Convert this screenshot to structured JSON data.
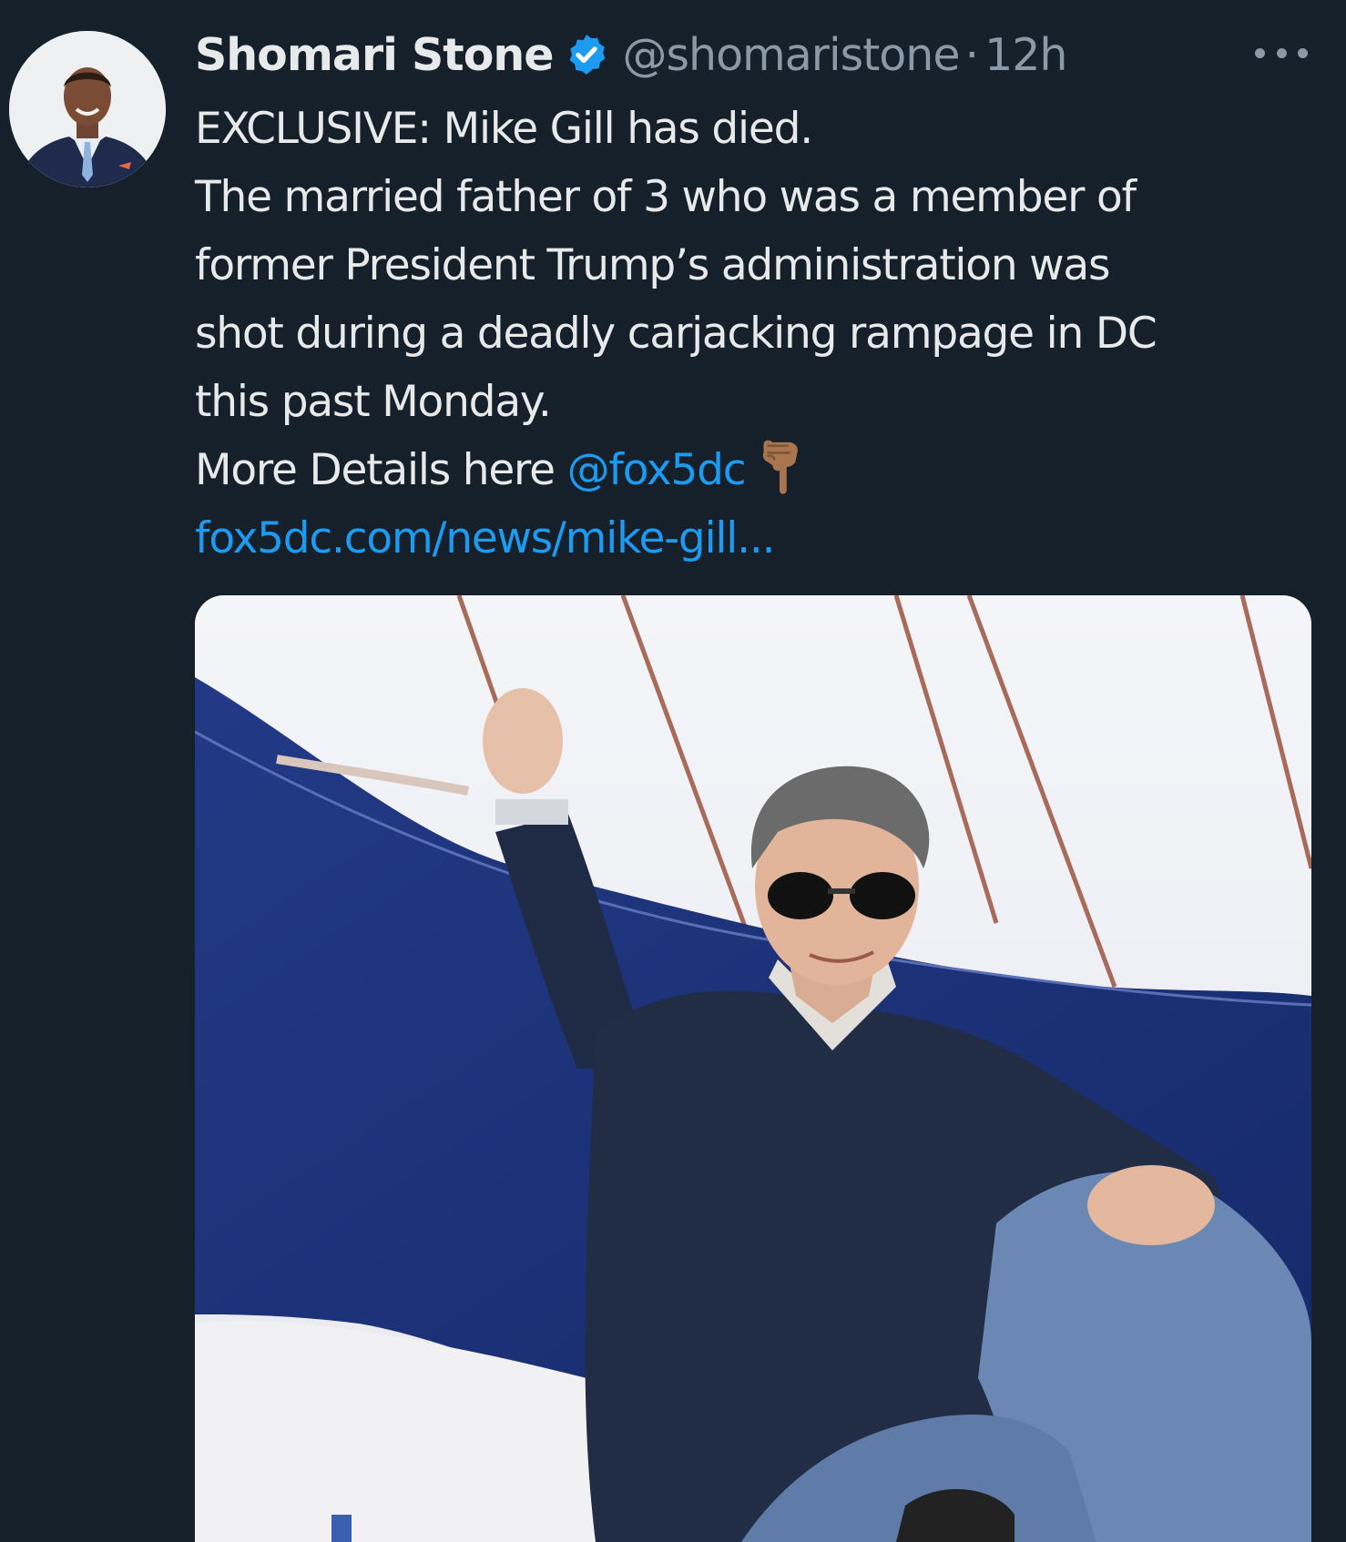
{
  "tweet": {
    "author": {
      "display_name": "Shomari Stone",
      "handle": "@shomaristone",
      "verified": true,
      "avatar_icon": "profile-photo"
    },
    "separator": "·",
    "timestamp": "12h",
    "more_icon": "more-horizontal-icon",
    "text_lines": [
      "EXCLUSIVE: Mike Gill has died.",
      "The married father of 3 who was a member of",
      "former President Trump’s administration was",
      "shot during a deadly carjacking rampage in DC",
      "this past Monday."
    ],
    "details_prefix": "More Details here ",
    "mention": "@fox5dc",
    "emoji": "backhand-index-pointing-down",
    "link": "fox5dc.com/news/mike-gill...",
    "media": {
      "type": "photo"
    }
  },
  "colors": {
    "background": "#15202b",
    "primary_text": "#e7e9ea",
    "secondary_text": "#8b98a5",
    "accent": "#1d9bf0"
  }
}
